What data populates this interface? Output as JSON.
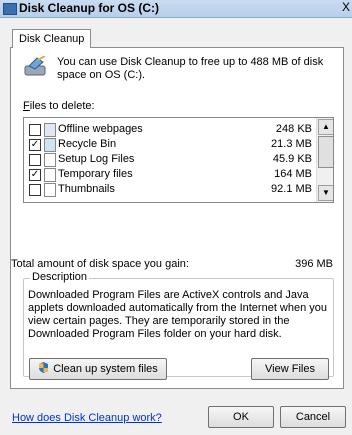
{
  "window": {
    "title": "Disk Cleanup for OS (C:)"
  },
  "tabs": [
    {
      "label": "Disk Cleanup"
    }
  ],
  "intro": {
    "text": "You can use Disk Cleanup to free up to 488 MB of disk space on OS (C:)."
  },
  "files_to_delete": {
    "label": "Files to delete:",
    "items": [
      {
        "name": "Offline webpages",
        "size": "248 KB",
        "checked": false,
        "icon": "offline-pages-icon"
      },
      {
        "name": "Recycle Bin",
        "size": "21.3 MB",
        "checked": true,
        "icon": "recycle-bin-icon"
      },
      {
        "name": "Setup Log Files",
        "size": "45.9 KB",
        "checked": false,
        "icon": "file-icon"
      },
      {
        "name": "Temporary files",
        "size": "164 MB",
        "checked": true,
        "icon": "file-icon"
      },
      {
        "name": "Thumbnails",
        "size": "92.1 MB",
        "checked": false,
        "icon": "file-icon"
      }
    ]
  },
  "total": {
    "label": "Total amount of disk space you gain:",
    "value": "396 MB"
  },
  "description": {
    "legend": "Description",
    "text": "Downloaded Program Files are ActiveX controls and Java applets downloaded automatically from the Internet when you view certain pages. They are temporarily stored in the Downloaded Program Files folder on your hard disk."
  },
  "buttons": {
    "cleanup_system": "Clean up system files",
    "view_files": "View Files",
    "ok": "OK",
    "cancel": "Cancel"
  },
  "help_link": "How does Disk Cleanup work?",
  "icons": {
    "app": "disk-cleanup-icon",
    "shield": "uac-shield-icon"
  }
}
